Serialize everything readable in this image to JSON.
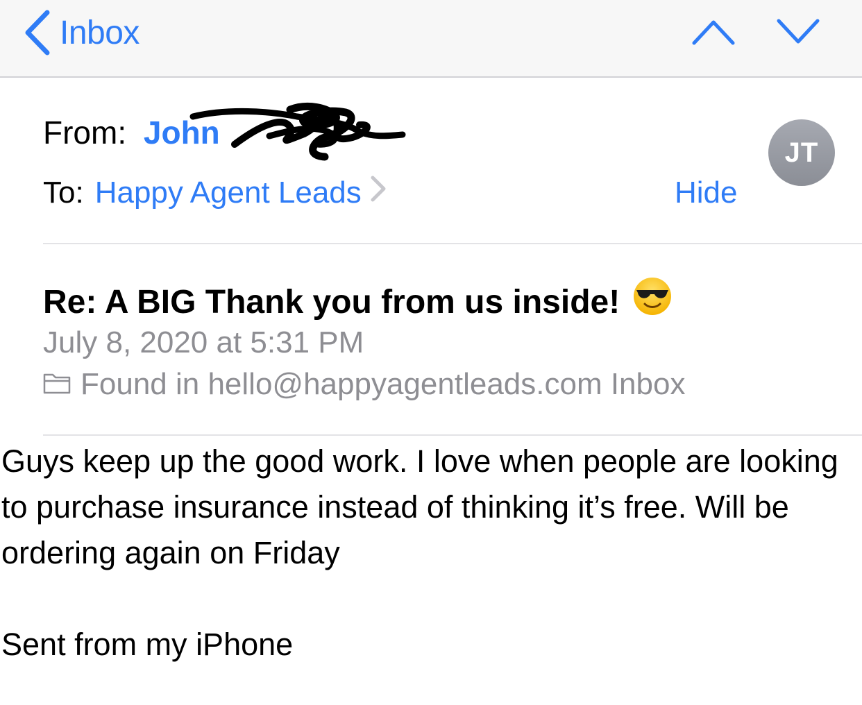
{
  "nav": {
    "back_label": "Inbox",
    "prev_icon": "chevron-up-icon",
    "next_icon": "chevron-down-icon"
  },
  "header": {
    "from_label": "From:",
    "from_name": "John",
    "to_label": "To:",
    "to_name": "Happy Agent Leads",
    "hide_label": "Hide",
    "avatar_initials": "JT"
  },
  "message": {
    "subject": "Re: A BIG Thank you from us inside!",
    "subject_emoji": "smiling-face-with-sunglasses",
    "date": "July 8, 2020 at 5:31 PM",
    "found_in": "Found in hello@happyagentleads.com Inbox",
    "body": "Guys keep up the good work. I love when people are looking to purchase insurance instead of thinking it’s free. Will be ordering again on Friday",
    "signature": "Sent from my iPhone"
  },
  "colors": {
    "accent": "#2f7cf6",
    "secondary_text": "#8e8e93",
    "avatar_bg": "#9a9da5"
  }
}
